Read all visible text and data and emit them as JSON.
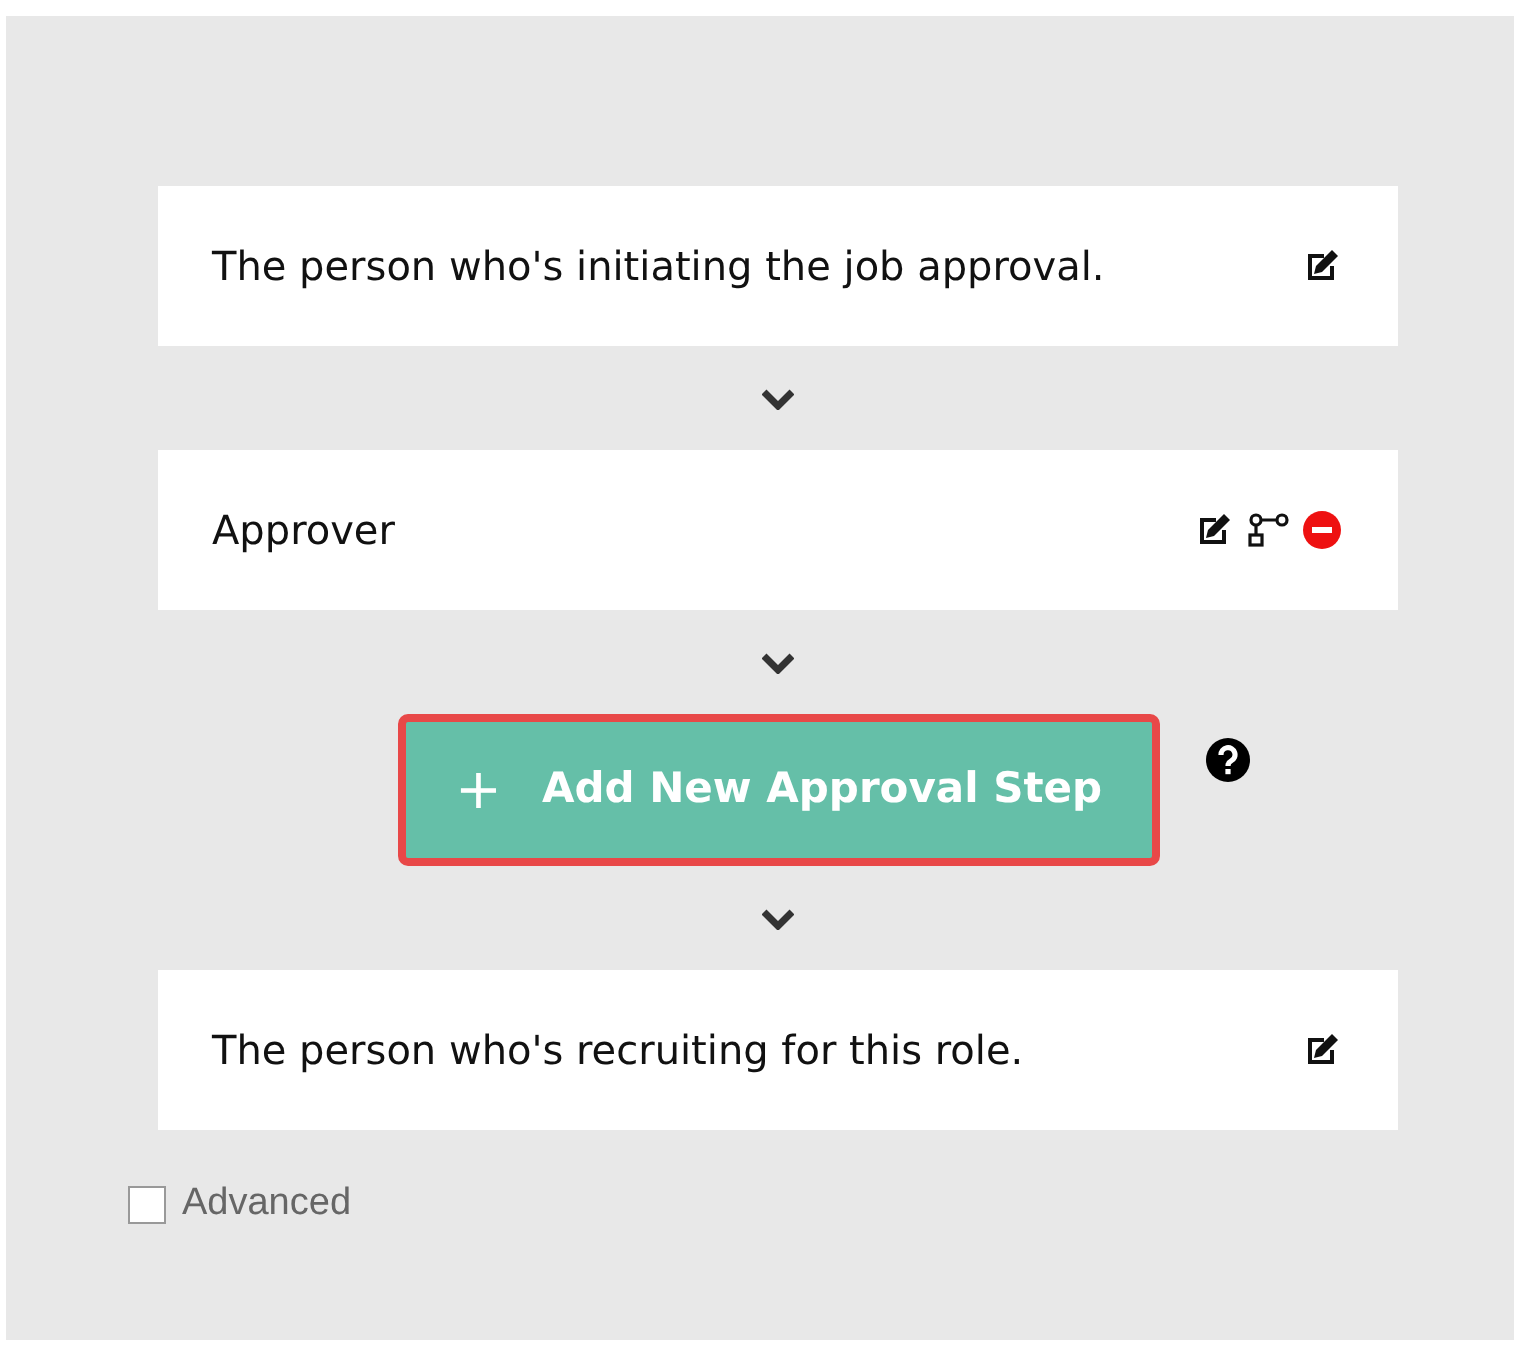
{
  "steps": [
    {
      "text": "The person who's initiating the job approval.",
      "actions": [
        {
          "kind": "edit"
        }
      ]
    },
    {
      "text": "Approver",
      "actions": [
        {
          "kind": "edit"
        },
        {
          "kind": "branch"
        },
        {
          "kind": "remove"
        }
      ]
    },
    {
      "kind": "add-button",
      "label": "+",
      "text": "Add New Approval Step"
    },
    {
      "text": "The person who's recruiting for this role.",
      "actions": [
        {
          "kind": "edit"
        }
      ]
    }
  ],
  "advanced": {
    "label": "Advanced",
    "checked": false
  }
}
